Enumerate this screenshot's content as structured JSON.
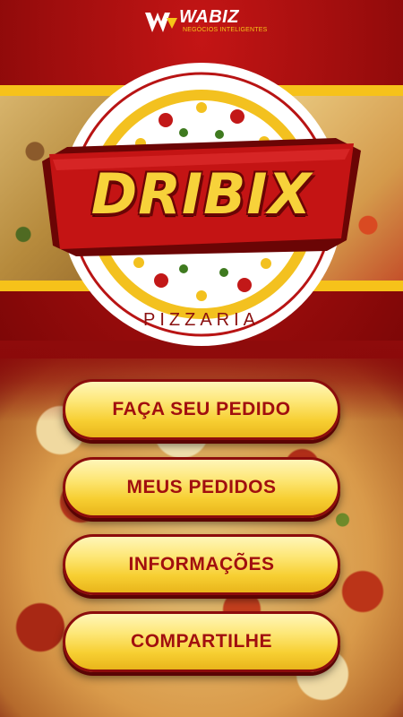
{
  "brand": {
    "name": "WABIZ",
    "tagline": "NEGÓCIOS INTELIGENTES"
  },
  "logo": {
    "title": "DRIBIX",
    "subtitle": "PIZZARIA"
  },
  "menu": {
    "items": [
      {
        "label": "FAÇA SEU PEDIDO"
      },
      {
        "label": "MEUS PEDIDOS"
      },
      {
        "label": "INFORMAÇÕES"
      },
      {
        "label": "COMPARTILHE"
      }
    ]
  },
  "colors": {
    "background_red": "#8e0b0b",
    "button_yellow": "#f7cf32",
    "button_text": "#a10f0f",
    "logo_yellow": "#f7d23a"
  }
}
